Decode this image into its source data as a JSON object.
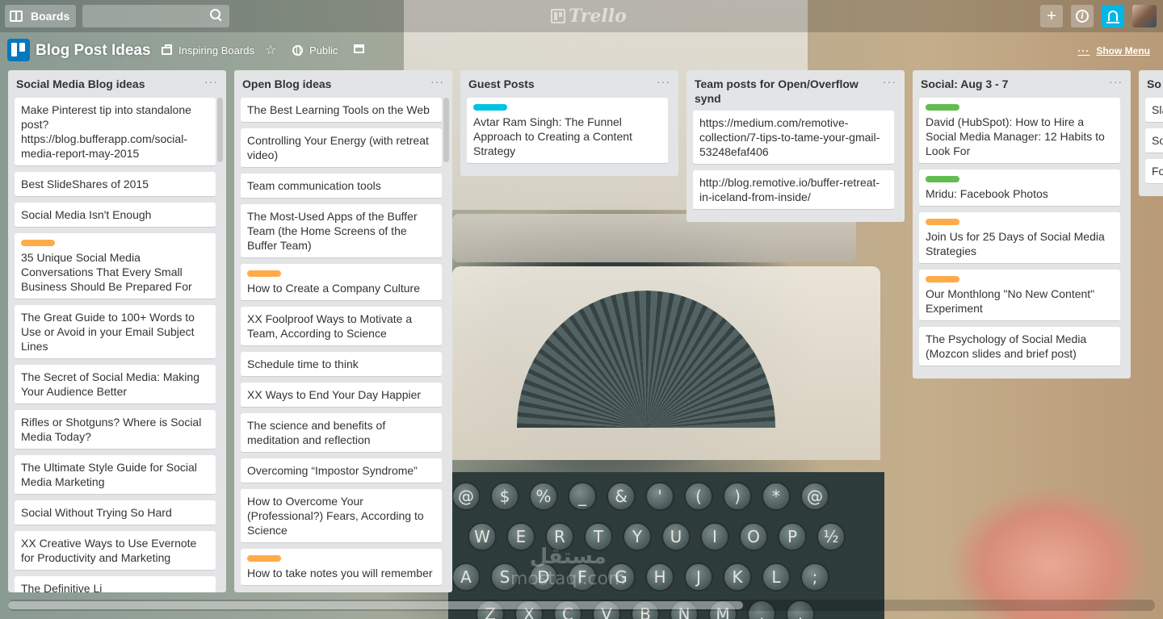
{
  "app": {
    "boards_label": "Boards",
    "logo_text": "Trello",
    "search_placeholder": ""
  },
  "board": {
    "title": "Blog Post Ideas",
    "organization": "Inspiring Boards",
    "visibility": "Public",
    "show_menu": "Show Menu"
  },
  "icons": {
    "boards": "boards-icon",
    "search": "search-icon",
    "add": "plus-icon",
    "info": "info-icon",
    "notifications": "bell-icon",
    "star": "star-icon",
    "archive": "archive-icon"
  },
  "colors": {
    "label_orange": "#ffab4a",
    "label_green": "#61bd4f",
    "label_cyan": "#00c2e0",
    "bell_active": "#00b7e6"
  },
  "lists": [
    {
      "title": "Social Media Blog ideas",
      "cards": [
        {
          "text": "Make Pinterest tip into standalone post? https://blog.bufferapp.com/social-media-report-may-2015"
        },
        {
          "text": "Best SlideShares of 2015"
        },
        {
          "text": "Social Media Isn't Enough"
        },
        {
          "text": "35 Unique Social Media Conversations That Every Small Business Should Be Prepared For",
          "label": "#ffab4a"
        },
        {
          "text": "The Great Guide to 100+ Words to Use or Avoid in your Email Subject Lines"
        },
        {
          "text": "The Secret of Social Media: Making Your Audience Better"
        },
        {
          "text": "Rifles or Shotguns? Where is Social Media Today?"
        },
        {
          "text": "The Ultimate Style Guide for Social Media Marketing"
        },
        {
          "text": "Social Without Trying So Hard"
        },
        {
          "text": "XX Creative Ways to Use Evernote for Productivity and Marketing"
        },
        {
          "text": "The Definitive Li"
        }
      ]
    },
    {
      "title": "Open Blog ideas",
      "cards": [
        {
          "text": "The Best Learning Tools on the Web"
        },
        {
          "text": "Controlling Your Energy (with retreat video)"
        },
        {
          "text": "Team communication tools"
        },
        {
          "text": "The Most-Used Apps of the Buffer Team (the Home Screens of the Buffer Team)"
        },
        {
          "text": "How to Create a Company Culture",
          "label": "#ffab4a"
        },
        {
          "text": "XX Foolproof Ways to Motivate a Team, According to Science"
        },
        {
          "text": "Schedule time to think"
        },
        {
          "text": "XX Ways to End Your Day Happier"
        },
        {
          "text": "The science and benefits of meditation and reflection"
        },
        {
          "text": "Overcoming “Impostor Syndrome”"
        },
        {
          "text": "How to Overcome Your (Professional?) Fears, According to Science"
        },
        {
          "text": "How to take notes you will remember",
          "label": "#ffab4a"
        }
      ]
    },
    {
      "title": "Guest Posts",
      "cards": [
        {
          "text": "Avtar Ram Singh: The Funnel Approach to Creating a Content Strategy",
          "label": "#00c2e0"
        }
      ]
    },
    {
      "title": "Team posts for Open/Overflow synd",
      "cards": [
        {
          "text": "https://medium.com/remotive-collection/7-tips-to-tame-your-gmail-53248efaf406"
        },
        {
          "text": "http://blog.remotive.io/buffer-retreat-in-iceland-from-inside/"
        }
      ]
    },
    {
      "title": "Social: Aug 3 - 7",
      "cards": [
        {
          "text": "David (HubSpot): How to Hire a Social Media Manager: 12 Habits to Look For",
          "label": "#61bd4f"
        },
        {
          "text": "Mridu: Facebook Photos",
          "label": "#61bd4f"
        },
        {
          "text": "Join Us for 25 Days of Social Media Strategies",
          "label": "#ffab4a"
        },
        {
          "text": "Our Monthlong \"No New Content\" Experiment",
          "label": "#ffab4a"
        },
        {
          "text": "The Psychology of Social Media (Mozcon slides and brief post)"
        }
      ]
    },
    {
      "title": "So",
      "cards": [
        {
          "text": "Sla gu"
        },
        {
          "text": "So"
        },
        {
          "text": "Fo Ge"
        }
      ]
    }
  ],
  "watermark": {
    "line1": "مستقل",
    "line2": "mostaql.com"
  }
}
